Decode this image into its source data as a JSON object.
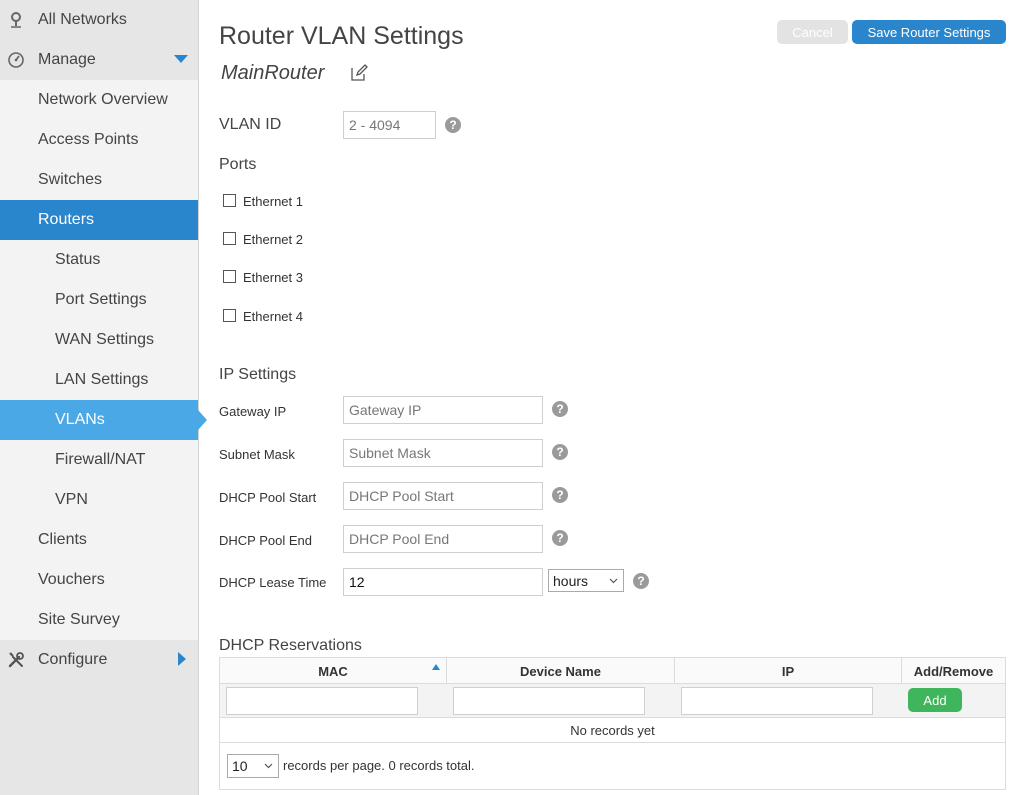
{
  "sidebar": {
    "all_networks": "All Networks",
    "manage": "Manage",
    "network_overview": "Network Overview",
    "access_points": "Access Points",
    "switches": "Switches",
    "routers": "Routers",
    "status": "Status",
    "port_settings": "Port Settings",
    "wan_settings": "WAN Settings",
    "lan_settings": "LAN Settings",
    "vlans": "VLANs",
    "firewall_nat": "Firewall/NAT",
    "vpn": "VPN",
    "clients": "Clients",
    "vouchers": "Vouchers",
    "site_survey": "Site Survey",
    "configure": "Configure",
    "icons": {
      "all_networks": "map-pin-icon",
      "manage": "dashboard-gauge-icon",
      "configure": "wrench-screwdriver-icon"
    }
  },
  "header": {
    "title": "Router VLAN Settings",
    "router_name": "MainRouter",
    "cancel": "Cancel",
    "save": "Save Router Settings"
  },
  "vlan": {
    "label": "VLAN ID",
    "placeholder": "2 - 4094"
  },
  "ports": {
    "label": "Ports",
    "items": [
      "Ethernet 1",
      "Ethernet 2",
      "Ethernet 3",
      "Ethernet 4"
    ]
  },
  "ip": {
    "section": "IP Settings",
    "gateway_label": "Gateway IP",
    "gateway_placeholder": "Gateway IP",
    "subnet_label": "Subnet Mask",
    "subnet_placeholder": "Subnet Mask",
    "pool_start_label": "DHCP Pool Start",
    "pool_start_placeholder": "DHCP Pool Start",
    "pool_end_label": "DHCP Pool End",
    "pool_end_placeholder": "DHCP Pool End",
    "lease_label": "DHCP Lease Time",
    "lease_value": "12",
    "lease_unit": "hours"
  },
  "reservations": {
    "title": "DHCP Reservations",
    "columns": [
      "MAC",
      "Device Name",
      "IP",
      "Add/Remove"
    ],
    "add": "Add",
    "empty": "No records yet",
    "page_size": "10",
    "footer": "records per page.  0 records total."
  },
  "colors": {
    "accent": "#2a86cc",
    "selected_sub": "#4aa8e6",
    "add_green": "#3fb65b"
  }
}
